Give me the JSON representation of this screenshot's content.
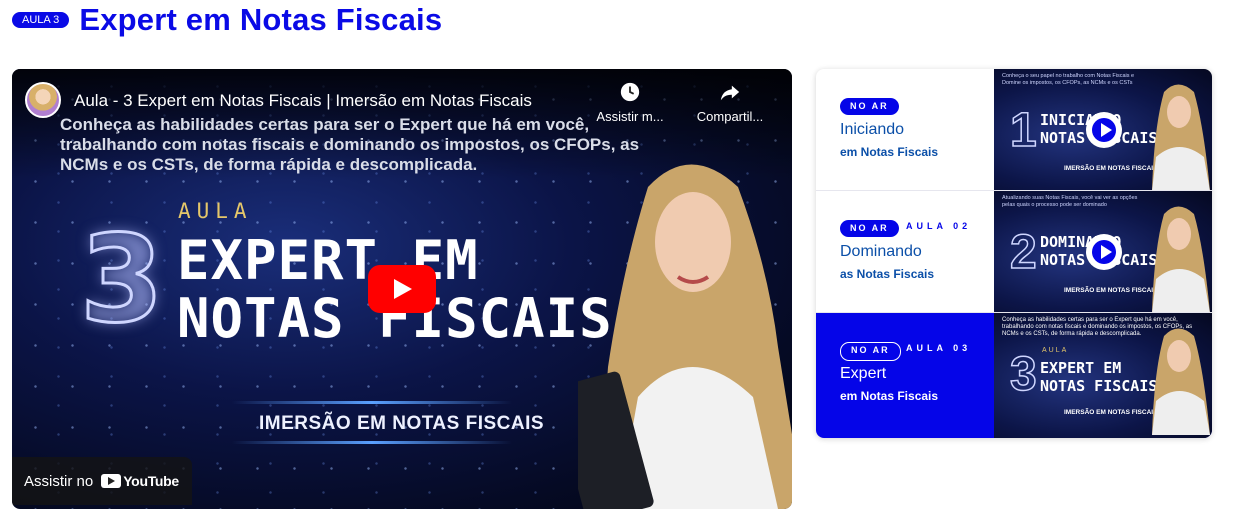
{
  "header": {
    "badge": "AULA 3",
    "title": "Expert em Notas Fiscais"
  },
  "player": {
    "video_title": "Aula - 3 Expert em Notas Fiscais | Imersão em Notas Fiscais",
    "watch_later_label": "Assistir m...",
    "share_label": "Compartil...",
    "description": "Conheça as habilidades certas para ser o Expert que há em você, trabalhando com notas fiscais e dominando os impostos, os CFOPs, as NCMs e os CSTs, de forma rápida e descomplicada.",
    "thumb_aula": "AULA",
    "thumb_number": "3",
    "thumb_line1": "EXPERT EM",
    "thumb_line2": "NOTAS FISCAIS",
    "thumb_subtitle": "IMERSÃO EM NOTAS FISCAIS",
    "watch_on_label": "Assistir no",
    "youtube_label": "YouTube"
  },
  "playlist": [
    {
      "badge": "NO AR",
      "aula": "",
      "title": "Iniciando",
      "subtitle": "em Notas Fiscais",
      "thumb_desc": "Conheça o seu papel no trabalho com Notas Fiscais e Domine os impostos, os CFOPs, as NCMs e os CSTs",
      "thumb_num": "1",
      "thumb_line1": "INICIANDO",
      "thumb_line2": "NOTAS FISCAIS",
      "thumb_sub": "IMERSÃO EM NOTAS FISCAIS"
    },
    {
      "badge": "NO AR",
      "aula": "AULA 02",
      "title": "Dominando",
      "subtitle": "as Notas Fiscais",
      "thumb_desc": "Atualizando suas Notas Fiscais, você vai ver as opções pelas quais o processo pode ser dominado",
      "thumb_num": "2",
      "thumb_line1": "DOMINANDO",
      "thumb_line2": "NOTAS FISCAIS",
      "thumb_sub": "IMERSÃO EM NOTAS FISCAIS"
    },
    {
      "badge": "NO AR",
      "aula": "AULA 03",
      "title": "Expert",
      "subtitle": "em Notas Fiscais",
      "thumb_desc": "Conheça as habilidades certas para ser o Expert que há em você, trabalhando com notas fiscais e dominando os impostos, os CFOPs, as NCMs e os CSTs, de forma rápida e descomplicada.",
      "thumb_aula": "AULA",
      "thumb_num": "3",
      "thumb_line1": "EXPERT EM",
      "thumb_line2": "NOTAS FISCAIS",
      "thumb_sub": "IMERSÃO EM NOTAS FISCAIS"
    }
  ],
  "colors": {
    "brand_blue": "#0505e8",
    "youtube_red": "#ff0000",
    "link_blue": "#0b4fa8"
  }
}
